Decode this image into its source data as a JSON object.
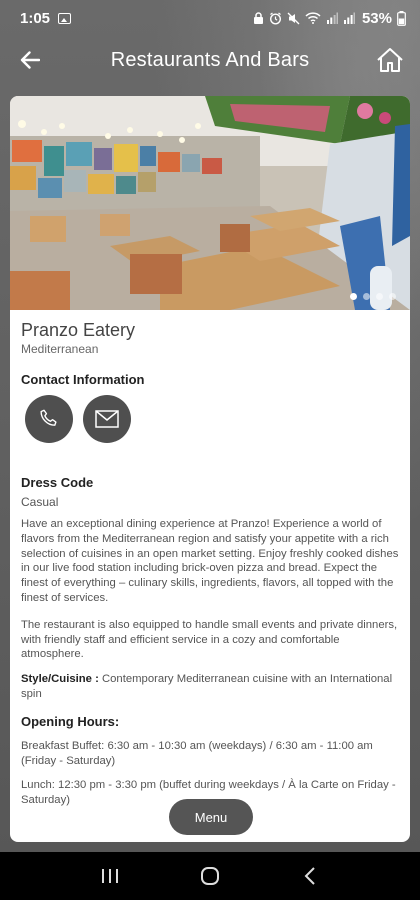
{
  "status_bar": {
    "time": "1:05",
    "battery": "53%",
    "icons": [
      "gallery-icon",
      "lock-icon",
      "alarm-icon",
      "mute-icon",
      "wifi-icon",
      "signal-icon",
      "signal-icon",
      "battery-icon"
    ]
  },
  "header": {
    "title": "Restaurants And Bars",
    "back_icon": "arrow-left-icon",
    "home_icon": "home-icon"
  },
  "gallery": {
    "slide_count": 4,
    "active_index": 0
  },
  "restaurant": {
    "name": "Pranzo Eatery",
    "cuisine_tag": "Mediterranean"
  },
  "contact": {
    "title": "Contact Information",
    "phone_icon": "phone-icon",
    "email_icon": "email-icon"
  },
  "dress_code": {
    "title": "Dress Code",
    "value": "Casual"
  },
  "description": [
    "Have an exceptional dining experience at Pranzo! Experience a world of flavors from the Mediterranean region and satisfy your appetite with a rich selection of cuisines in an open market setting. Enjoy freshly cooked dishes in our live food station including brick-oven pizza and bread. Expect the finest of everything – culinary skills, ingredients, flavors, all topped with the finest of services.",
    "The restaurant is also equipped to handle small events and private dinners, with friendly staff and efficient service in a cozy and comfortable atmosphere."
  ],
  "style_cuisine": {
    "label": "Style/Cuisine :",
    "value": " Contemporary Mediterranean cuisine with an International spin"
  },
  "opening_hours": {
    "title": "Opening Hours:",
    "lines": [
      "Breakfast Buffet: 6:30 am - 10:30 am (weekdays) / 6:30 am - 11:00 am (Friday - Saturday)",
      "Lunch: 12:30 pm - 3:30 pm (buffet during weekdays / À la Carte on Friday - Saturday)"
    ]
  },
  "menu_button": "Menu",
  "nav": {
    "recents_icon": "recents-icon",
    "home_icon": "home-circle-icon",
    "back_icon": "chevron-left-icon"
  },
  "colors": {
    "background": "#5d5d5d",
    "button": "#4f4f4f",
    "card": "#ffffff"
  }
}
